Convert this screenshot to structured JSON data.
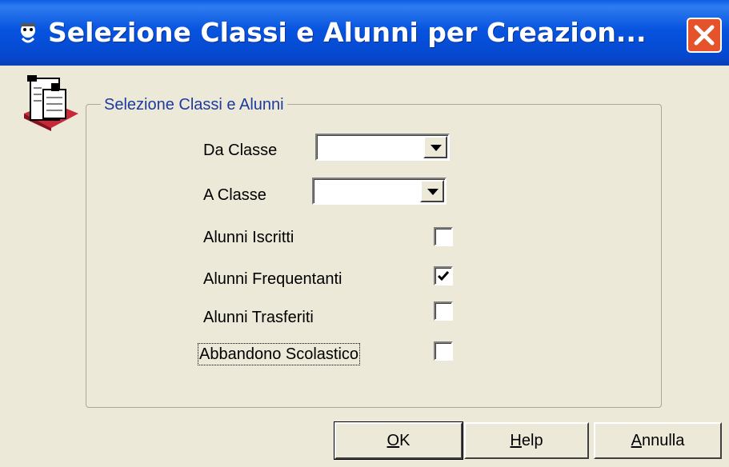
{
  "window": {
    "title": "Selezione Classi e Alunni per Creazion...",
    "title_icon": "app-icon",
    "close_icon": "close-icon"
  },
  "icons": {
    "document": "document-printer-icon",
    "dropdown": "chevron-down-icon",
    "check": "check-icon"
  },
  "group": {
    "legend": "Selezione Classi e Alunni",
    "da_classe_label": "Da Classe",
    "da_classe_value": "",
    "a_classe_label": "A Classe",
    "a_classe_value": "",
    "checkboxes": [
      {
        "label": "Alunni Iscritti",
        "checked": false
      },
      {
        "label": "Alunni Frequentanti",
        "checked": true
      },
      {
        "label": "Alunni Trasferiti",
        "checked": false
      },
      {
        "label": "Abbandono Scolastico",
        "checked": false
      }
    ]
  },
  "buttons": {
    "ok_hotkey": "O",
    "ok_rest": "K",
    "help_hotkey": "H",
    "help_rest": "elp",
    "annulla_hotkey": "A",
    "annulla_rest": "nnulla"
  },
  "colors": {
    "titlebar": "#0754df",
    "background": "#ece9d8",
    "legend_text": "#1d3a9e",
    "close_button": "#e4532c"
  }
}
